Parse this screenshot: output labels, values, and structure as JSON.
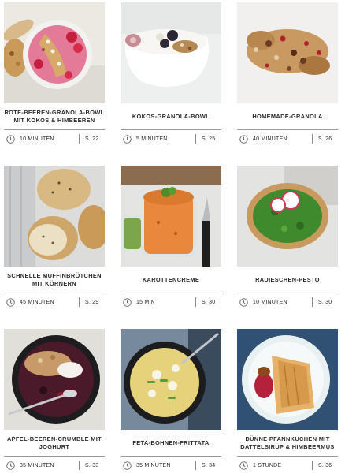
{
  "recipes": [
    {
      "title": "ROTE-BEEREN-GRANOLA-BOWL MIT KOKOS & HIMBEEREN",
      "time": "10 MINUTEN",
      "page": "S. 22",
      "image": "berry-granola-bowl"
    },
    {
      "title": "KOKOS-GRANOLA-BOWL",
      "time": "5 MINUTEN",
      "page": "S. 25",
      "image": "coconut-granola-bowl"
    },
    {
      "title": "HOMEMADE-GRANOLA",
      "time": "40 MINUTEN",
      "page": "S. 26",
      "image": "homemade-granola"
    },
    {
      "title": "SCHNELLE MUFFINBRÖTCHEN MIT KÖRNERN",
      "time": "45 MINUTEN",
      "page": "S. 29",
      "image": "seeded-rolls"
    },
    {
      "title": "KAROTTENCREME",
      "time": "15 MIN",
      "page": "S. 30",
      "image": "carrot-spread-jar"
    },
    {
      "title": "RADIESCHEN-PESTO",
      "time": "10 MINUTEN",
      "page": "S. 30",
      "image": "radish-pesto-bread"
    },
    {
      "title": "APFEL-BEEREN-CRUMBLE MIT JOGHURT",
      "time": "35 MINUTEN",
      "page": "S. 33",
      "image": "apple-berry-crumble"
    },
    {
      "title": "FETA-BOHNEN-FRITTATA",
      "time": "35 MINUTEN",
      "page": "S. 34",
      "image": "feta-bean-frittata"
    },
    {
      "title": "DÜNNE PFANNKUCHEN MIT DATTELSIRUP & HIMBEERMUS",
      "time": "1 STUNDE",
      "page": "S. 36",
      "image": "thin-pancakes"
    }
  ],
  "icons": {
    "clock": "clock-icon"
  },
  "colors": {
    "text": "#2a2a2a",
    "rule": "#9a9a9a",
    "background": "#ffffff"
  }
}
